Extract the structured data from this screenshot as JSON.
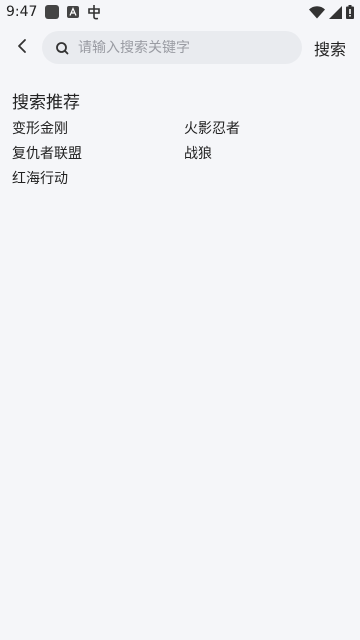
{
  "status_bar": {
    "time": "9:47",
    "icons_left": [
      "app-square-icon",
      "font-a-icon",
      "notification-glyph-icon"
    ],
    "icons_right": [
      "wifi-icon",
      "signal-icon",
      "battery-icon"
    ]
  },
  "header": {
    "search": {
      "placeholder": "请输入搜索关键字",
      "value": ""
    },
    "search_button_label": "搜索"
  },
  "recommendations": {
    "title": "搜索推荐",
    "items": [
      {
        "label": "变形金刚"
      },
      {
        "label": "火影忍者"
      },
      {
        "label": "复仇者联盟"
      },
      {
        "label": "战狼"
      },
      {
        "label": "红海行动"
      }
    ]
  }
}
